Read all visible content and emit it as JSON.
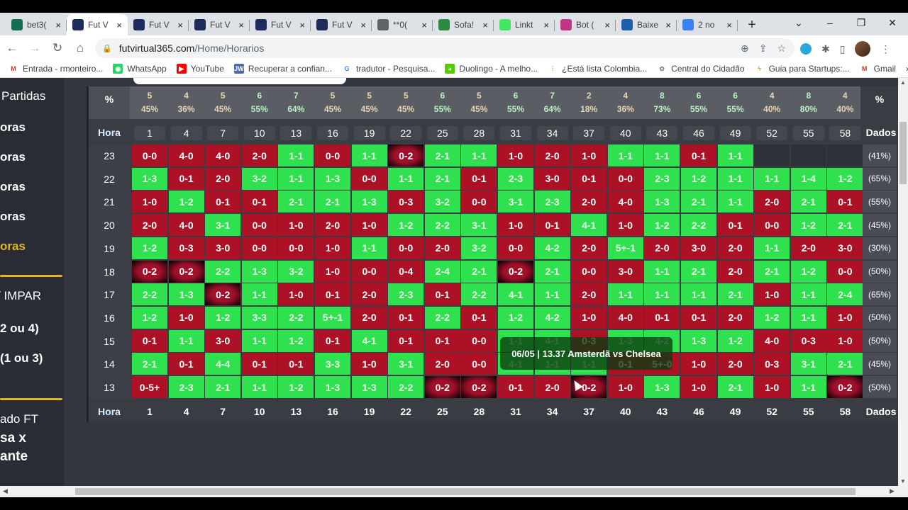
{
  "browser": {
    "tabs": [
      {
        "label": "bet3(",
        "icon": "bet365-icon",
        "color": "#126e51",
        "active": false
      },
      {
        "label": "Fut V",
        "icon": "futvirtual-icon",
        "color": "#1c2a5c",
        "active": true
      },
      {
        "label": "Fut V",
        "icon": "futvirtual-icon",
        "color": "#1c2a5c",
        "active": false
      },
      {
        "label": "Fut V",
        "icon": "futvirtual-icon",
        "color": "#1c2a5c",
        "active": false
      },
      {
        "label": "Fut V",
        "icon": "futvirtual-icon",
        "color": "#1c2a5c",
        "active": false
      },
      {
        "label": "Fut V",
        "icon": "futvirtual-icon",
        "color": "#1c2a5c",
        "active": false
      },
      {
        "label": "**0(",
        "icon": "globe-icon",
        "color": "#5f6368",
        "active": false
      },
      {
        "label": "Sofa!",
        "icon": "sofascore-icon",
        "color": "#2b8a3e",
        "active": false
      },
      {
        "label": "Linkt",
        "icon": "linktree-icon",
        "color": "#43e660",
        "active": false
      },
      {
        "label": "Bot (",
        "icon": "instagram-icon",
        "color": "#c13584",
        "active": false
      },
      {
        "label": "Baixe",
        "icon": "download-icon",
        "color": "#1d5fa8",
        "active": false
      },
      {
        "label": "2 no",
        "icon": "number-badge-icon",
        "color": "#3b82f6",
        "active": false
      }
    ],
    "new_tab": "+",
    "url_domain": "futvirtual365.com",
    "url_path": "/Home/Horarios",
    "bookmarks": [
      {
        "label": "Entrada - rmonteiro...",
        "icon": "gmail-icon"
      },
      {
        "label": "WhatsApp",
        "icon": "whatsapp-icon"
      },
      {
        "label": "YouTube",
        "icon": "youtube-icon"
      },
      {
        "label": "Recuperar a confian...",
        "icon": "jw-icon"
      },
      {
        "label": "tradutor - Pesquisa...",
        "icon": "google-icon"
      },
      {
        "label": "Duolingo - A melho...",
        "icon": "duolingo-icon"
      },
      {
        "label": "¿Está lista Colombia...",
        "icon": "chart-icon"
      },
      {
        "label": "Central do Cidadão",
        "icon": "people-icon"
      },
      {
        "label": "Guia para Startups:...",
        "icon": "bolt-icon"
      },
      {
        "label": "Gmail",
        "icon": "gmail-icon"
      }
    ],
    "more_bookmarks": "»"
  },
  "sidebar": {
    "items": [
      {
        "label": "Partidas",
        "active": false
      },
      {
        "label": "oras",
        "active": false
      },
      {
        "label": "oras",
        "active": false
      },
      {
        "label": "oras",
        "active": false
      },
      {
        "label": "oras",
        "active": false
      },
      {
        "label": "oras",
        "active": true
      },
      {
        "label": "/ IMPAR",
        "active": false
      },
      {
        "label": "2 ou 4)",
        "active": false
      },
      {
        "label": "(1 ou 3)",
        "active": false
      },
      {
        "label": "ado FT",
        "active": false
      },
      {
        "label": "sa x",
        "active": false
      },
      {
        "label": "ante",
        "active": false
      }
    ],
    "accent": "#e2b71f"
  },
  "grid": {
    "pct_label": "%",
    "hora_label": "Hora",
    "dados_label": "Dados",
    "minutes": [
      "1",
      "4",
      "7",
      "10",
      "13",
      "16",
      "19",
      "22",
      "25",
      "28",
      "31",
      "34",
      "37",
      "40",
      "43",
      "46",
      "49",
      "52",
      "55",
      "58"
    ],
    "top_counts": [
      "5",
      "4",
      "5",
      "6",
      "7",
      "5",
      "5",
      "5",
      "6",
      "5",
      "6",
      "7",
      "2",
      "4",
      "8",
      "6",
      "6",
      "4",
      "8",
      "4"
    ],
    "top_pcts": [
      "45%",
      "36%",
      "45%",
      "55%",
      "64%",
      "45%",
      "45%",
      "45%",
      "55%",
      "45%",
      "55%",
      "64%",
      "18%",
      "36%",
      "73%",
      "55%",
      "55%",
      "40%",
      "80%",
      "40%"
    ],
    "rows": [
      {
        "hour": "23",
        "dados": "(41%)",
        "cells": [
          [
            "0-0",
            "r"
          ],
          [
            "4-0",
            "r"
          ],
          [
            "4-0",
            "r"
          ],
          [
            "2-0",
            "r"
          ],
          [
            "1-1",
            "g"
          ],
          [
            "0-0",
            "r"
          ],
          [
            "1-1",
            "g"
          ],
          [
            "0-2",
            "hl"
          ],
          [
            "2-1",
            "g"
          ],
          [
            "1-1",
            "g"
          ],
          [
            "1-0",
            "r"
          ],
          [
            "2-0",
            "r"
          ],
          [
            "1-0",
            "r"
          ],
          [
            "1-1",
            "g"
          ],
          [
            "1-1",
            "g"
          ],
          [
            "0-1",
            "r"
          ],
          [
            "1-1",
            "g"
          ],
          [
            "",
            "e"
          ],
          [
            "",
            "e"
          ],
          [
            "",
            "e"
          ]
        ]
      },
      {
        "hour": "22",
        "dados": "(65%)",
        "cells": [
          [
            "1-3",
            "g"
          ],
          [
            "0-1",
            "r"
          ],
          [
            "2-0",
            "r"
          ],
          [
            "3-2",
            "g"
          ],
          [
            "1-1",
            "g"
          ],
          [
            "1-3",
            "g"
          ],
          [
            "0-0",
            "r"
          ],
          [
            "1-1",
            "g"
          ],
          [
            "2-1",
            "g"
          ],
          [
            "0-1",
            "r"
          ],
          [
            "2-3",
            "g"
          ],
          [
            "3-0",
            "r"
          ],
          [
            "0-1",
            "r"
          ],
          [
            "0-0",
            "r"
          ],
          [
            "2-3",
            "g"
          ],
          [
            "1-2",
            "g"
          ],
          [
            "1-1",
            "g"
          ],
          [
            "1-1",
            "g"
          ],
          [
            "1-4",
            "g"
          ],
          [
            "1-2",
            "g"
          ]
        ]
      },
      {
        "hour": "21",
        "dados": "(55%)",
        "cells": [
          [
            "1-0",
            "r"
          ],
          [
            "1-2",
            "g"
          ],
          [
            "0-1",
            "r"
          ],
          [
            "0-1",
            "r"
          ],
          [
            "2-1",
            "g"
          ],
          [
            "2-1",
            "g"
          ],
          [
            "1-3",
            "g"
          ],
          [
            "0-3",
            "r"
          ],
          [
            "3-2",
            "g"
          ],
          [
            "0-0",
            "r"
          ],
          [
            "3-1",
            "g"
          ],
          [
            "2-3",
            "g"
          ],
          [
            "2-0",
            "r"
          ],
          [
            "4-0",
            "r"
          ],
          [
            "1-3",
            "g"
          ],
          [
            "2-1",
            "g"
          ],
          [
            "1-1",
            "g"
          ],
          [
            "2-0",
            "r"
          ],
          [
            "2-1",
            "g"
          ],
          [
            "0-1",
            "r"
          ]
        ]
      },
      {
        "hour": "20",
        "dados": "(45%)",
        "cells": [
          [
            "2-0",
            "r"
          ],
          [
            "4-0",
            "r"
          ],
          [
            "3-1",
            "g"
          ],
          [
            "0-0",
            "r"
          ],
          [
            "1-0",
            "r"
          ],
          [
            "2-0",
            "r"
          ],
          [
            "1-0",
            "r"
          ],
          [
            "1-2",
            "g"
          ],
          [
            "2-2",
            "g"
          ],
          [
            "3-1",
            "g"
          ],
          [
            "1-0",
            "r"
          ],
          [
            "0-1",
            "r"
          ],
          [
            "4-1",
            "g"
          ],
          [
            "1-0",
            "r"
          ],
          [
            "1-2",
            "g"
          ],
          [
            "2-2",
            "g"
          ],
          [
            "0-1",
            "r"
          ],
          [
            "0-0",
            "r"
          ],
          [
            "1-2",
            "g"
          ],
          [
            "2-1",
            "g"
          ]
        ]
      },
      {
        "hour": "19",
        "dados": "(30%)",
        "cells": [
          [
            "1-2",
            "g"
          ],
          [
            "0-3",
            "r"
          ],
          [
            "3-0",
            "r"
          ],
          [
            "0-0",
            "r"
          ],
          [
            "0-0",
            "r"
          ],
          [
            "1-0",
            "r"
          ],
          [
            "1-1",
            "g"
          ],
          [
            "0-0",
            "r"
          ],
          [
            "2-0",
            "r"
          ],
          [
            "3-2",
            "g"
          ],
          [
            "0-0",
            "r"
          ],
          [
            "4-2",
            "g"
          ],
          [
            "2-0",
            "r"
          ],
          [
            "5+-1",
            "g"
          ],
          [
            "2-0",
            "r"
          ],
          [
            "3-0",
            "r"
          ],
          [
            "2-0",
            "r"
          ],
          [
            "1-1",
            "g"
          ],
          [
            "2-0",
            "r"
          ],
          [
            "3-0",
            "r"
          ]
        ]
      },
      {
        "hour": "18",
        "dados": "(50%)",
        "cells": [
          [
            "0-2",
            "hl"
          ],
          [
            "0-2",
            "hl"
          ],
          [
            "2-2",
            "g"
          ],
          [
            "1-3",
            "g"
          ],
          [
            "3-2",
            "g"
          ],
          [
            "1-0",
            "r"
          ],
          [
            "0-0",
            "r"
          ],
          [
            "0-4",
            "r"
          ],
          [
            "2-4",
            "g"
          ],
          [
            "2-1",
            "g"
          ],
          [
            "0-2",
            "hl"
          ],
          [
            "2-1",
            "g"
          ],
          [
            "0-0",
            "r"
          ],
          [
            "3-0",
            "r"
          ],
          [
            "1-1",
            "g"
          ],
          [
            "2-1",
            "g"
          ],
          [
            "2-0",
            "r"
          ],
          [
            "2-1",
            "g"
          ],
          [
            "1-2",
            "g"
          ],
          [
            "0-0",
            "r"
          ]
        ]
      },
      {
        "hour": "17",
        "dados": "(65%)",
        "cells": [
          [
            "2-2",
            "g"
          ],
          [
            "1-3",
            "g"
          ],
          [
            "0-2",
            "hl"
          ],
          [
            "1-1",
            "g"
          ],
          [
            "1-0",
            "r"
          ],
          [
            "0-1",
            "r"
          ],
          [
            "2-0",
            "r"
          ],
          [
            "2-3",
            "g"
          ],
          [
            "0-1",
            "r"
          ],
          [
            "2-2",
            "g"
          ],
          [
            "4-1",
            "g"
          ],
          [
            "1-1",
            "g"
          ],
          [
            "2-0",
            "r"
          ],
          [
            "1-1",
            "g"
          ],
          [
            "1-1",
            "g"
          ],
          [
            "1-1",
            "g"
          ],
          [
            "2-1",
            "g"
          ],
          [
            "1-0",
            "r"
          ],
          [
            "1-1",
            "g"
          ],
          [
            "2-4",
            "g"
          ]
        ]
      },
      {
        "hour": "16",
        "dados": "(50%)",
        "cells": [
          [
            "1-2",
            "g"
          ],
          [
            "1-0",
            "r"
          ],
          [
            "1-2",
            "g"
          ],
          [
            "3-3",
            "g"
          ],
          [
            "2-2",
            "g"
          ],
          [
            "5+-1",
            "g"
          ],
          [
            "2-0",
            "r"
          ],
          [
            "0-1",
            "r"
          ],
          [
            "2-2",
            "g"
          ],
          [
            "0-1",
            "r"
          ],
          [
            "1-2",
            "g"
          ],
          [
            "4-2",
            "g"
          ],
          [
            "1-0",
            "r"
          ],
          [
            "4-0",
            "r"
          ],
          [
            "0-1",
            "r"
          ],
          [
            "0-1",
            "r"
          ],
          [
            "2-0",
            "r"
          ],
          [
            "1-2",
            "g"
          ],
          [
            "1-1",
            "g"
          ],
          [
            "1-0",
            "r"
          ]
        ]
      },
      {
        "hour": "15",
        "dados": "(50%)",
        "cells": [
          [
            "0-1",
            "r"
          ],
          [
            "1-1",
            "g"
          ],
          [
            "3-0",
            "r"
          ],
          [
            "1-1",
            "g"
          ],
          [
            "1-2",
            "g"
          ],
          [
            "0-1",
            "r"
          ],
          [
            "4-1",
            "g"
          ],
          [
            "0-1",
            "r"
          ],
          [
            "0-1",
            "r"
          ],
          [
            "0-0",
            "r"
          ],
          [
            "1-1",
            "g"
          ],
          [
            "4-1",
            "g"
          ],
          [
            "0-3",
            "r"
          ],
          [
            "1-3",
            "g"
          ],
          [
            "4-2",
            "g"
          ],
          [
            "1-3",
            "g"
          ],
          [
            "1-2",
            "g"
          ],
          [
            "4-0",
            "r"
          ],
          [
            "0-3",
            "r"
          ],
          [
            "1-0",
            "r"
          ]
        ]
      },
      {
        "hour": "14",
        "dados": "(45%)",
        "cells": [
          [
            "2-1",
            "g"
          ],
          [
            "0-1",
            "r"
          ],
          [
            "4-4",
            "g"
          ],
          [
            "0-1",
            "r"
          ],
          [
            "0-1",
            "r"
          ],
          [
            "3-3",
            "g"
          ],
          [
            "1-0",
            "r"
          ],
          [
            "3-1",
            "g"
          ],
          [
            "2-0",
            "r"
          ],
          [
            "0-0",
            "r"
          ],
          [
            "4-1",
            "g"
          ],
          [
            "1-1",
            "g"
          ],
          [
            "1-1",
            "g"
          ],
          [
            "0-1",
            "r"
          ],
          [
            "5+-0",
            "r"
          ],
          [
            "1-0",
            "r"
          ],
          [
            "2-0",
            "r"
          ],
          [
            "0-3",
            "r"
          ],
          [
            "3-1",
            "g"
          ],
          [
            "2-1",
            "g"
          ]
        ]
      },
      {
        "hour": "13",
        "dados": "(50%)",
        "cells": [
          [
            "0-5+",
            "r"
          ],
          [
            "2-3",
            "g"
          ],
          [
            "2-1",
            "g"
          ],
          [
            "1-1",
            "g"
          ],
          [
            "1-2",
            "g"
          ],
          [
            "1-3",
            "g"
          ],
          [
            "1-3",
            "g"
          ],
          [
            "2-2",
            "g"
          ],
          [
            "0-2",
            "hl"
          ],
          [
            "0-2",
            "hl"
          ],
          [
            "0-1",
            "r"
          ],
          [
            "2-0",
            "r"
          ],
          [
            "0-2",
            "hl"
          ],
          [
            "1-0",
            "r"
          ],
          [
            "1-3",
            "g"
          ],
          [
            "1-0",
            "r"
          ],
          [
            "2-1",
            "g"
          ],
          [
            "1-0",
            "r"
          ],
          [
            "1-1",
            "g"
          ],
          [
            "0-2",
            "hl"
          ]
        ]
      }
    ]
  },
  "tooltip": {
    "text": "06/05 | 13.37 Amsterdã vs Chelsea"
  },
  "colors": {
    "green": "#2fe04f",
    "red": "#ad1126",
    "pct_low": "#e6d7b0",
    "pct_high": "#b9f0c5"
  }
}
